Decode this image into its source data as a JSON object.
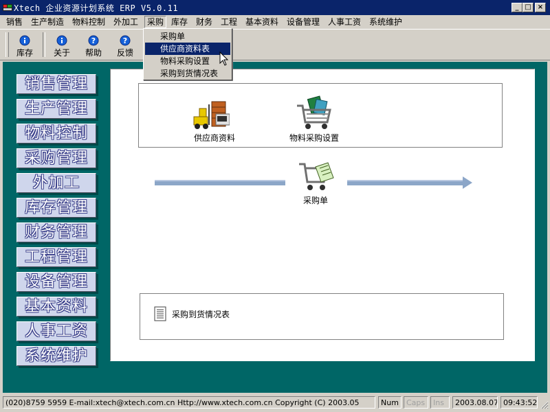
{
  "window": {
    "title": "Xtech 企业资源计划系统 ERP V5.0.11",
    "minimize": "_",
    "maximize": "□",
    "close": "×"
  },
  "menubar": [
    {
      "label": "销售",
      "open": false
    },
    {
      "label": "生产制造",
      "open": false
    },
    {
      "label": "物料控制",
      "open": false
    },
    {
      "label": "外加工",
      "open": false
    },
    {
      "label": "采购",
      "open": true
    },
    {
      "label": "库存",
      "open": false
    },
    {
      "label": "财务",
      "open": false
    },
    {
      "label": "工程",
      "open": false
    },
    {
      "label": "基本资料",
      "open": false
    },
    {
      "label": "设备管理",
      "open": false
    },
    {
      "label": "人事工资",
      "open": false
    },
    {
      "label": "系统维护",
      "open": false
    }
  ],
  "toolbar": [
    {
      "label": "库存",
      "icon": "info-icon"
    },
    {
      "label": "关于",
      "icon": "info-icon"
    },
    {
      "label": "帮助",
      "icon": "help-icon"
    },
    {
      "label": "反馈",
      "icon": "help-icon"
    }
  ],
  "dropdown": {
    "items": [
      "采购单",
      "供应商资料表",
      "物料采购设置",
      "采购到货情况表"
    ],
    "highlighted_index": 1
  },
  "nav": [
    "销售管理",
    "生产管理",
    "物料控制",
    "采购管理",
    "外加工",
    "库存管理",
    "财务管理",
    "工程管理",
    "设备管理",
    "基本资料",
    "人事工资",
    "系统维护"
  ],
  "workspace": {
    "top_icons": [
      {
        "label": "供应商资料",
        "icon": "forklift-warehouse-icon"
      },
      {
        "label": "物料采购设置",
        "icon": "shopping-cart-icon"
      }
    ],
    "flow_icon": {
      "label": "采购单",
      "icon": "cart-document-icon"
    },
    "report": {
      "label": "采购到货情况表",
      "icon": "report-document-icon"
    }
  },
  "statusbar": {
    "info": "(020)8759 5959  E-mail:xtech@xtech.com.cn  Http://www.xtech.com.cn Copyright (C) 2003.05",
    "num": "Num",
    "caps": "Caps",
    "ins": "Ins",
    "date": "2003.08.07",
    "time": "09:43:52"
  },
  "colors": {
    "titlebar": "#0a246a",
    "workspace_bg": "#006666",
    "nav_button": "#cfd6ec",
    "flow_arrow": "#8ca6c8",
    "highlight": "#0a246a"
  }
}
